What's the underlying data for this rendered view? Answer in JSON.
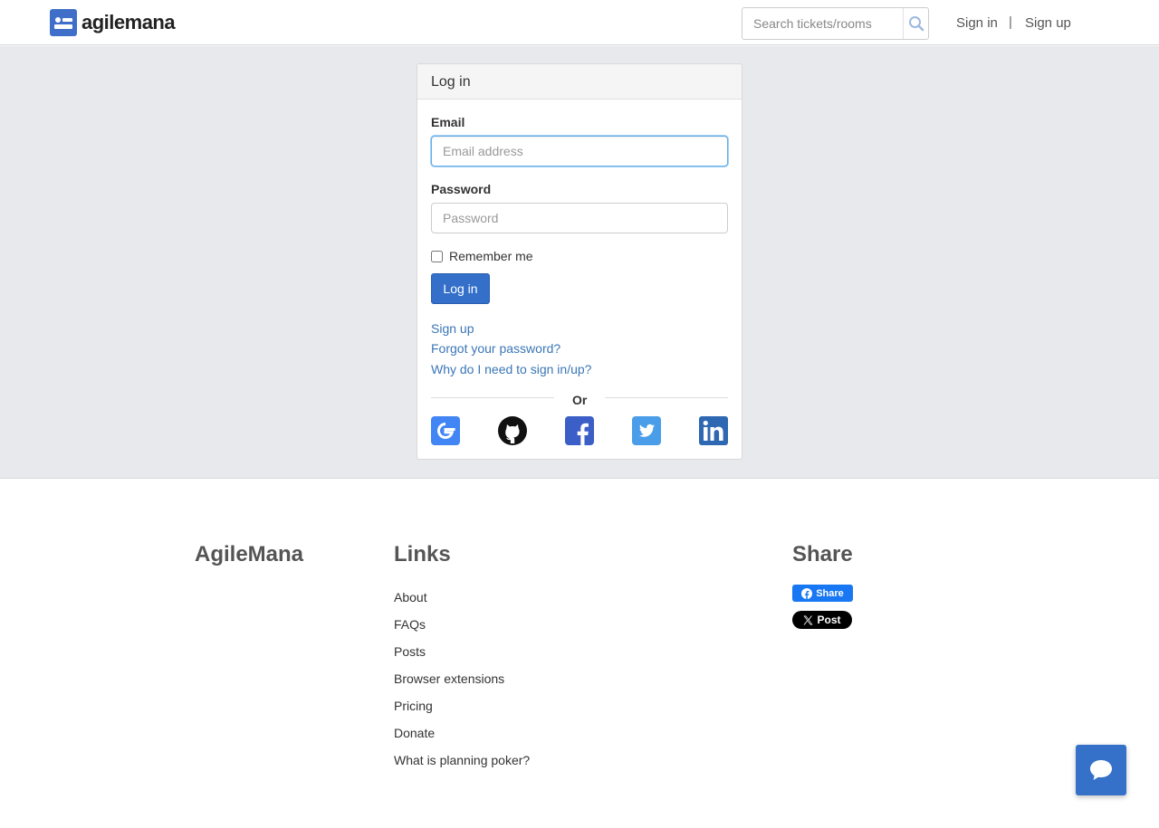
{
  "header": {
    "brand": "agilemana",
    "search_placeholder": "Search tickets/rooms",
    "signin": "Sign in",
    "separator": "|",
    "signup": "Sign up"
  },
  "login": {
    "title": "Log in",
    "email_label": "Email",
    "email_placeholder": "Email address",
    "password_label": "Password",
    "password_placeholder": "Password",
    "remember_label": "Remember me",
    "submit_label": "Log in",
    "links": [
      "Sign up",
      "Forgot your password?",
      "Why do I need to sign in/up?"
    ],
    "or_text": "Or",
    "social_icons": [
      "google-icon",
      "github-icon",
      "facebook-icon",
      "twitter-icon",
      "linkedin-icon"
    ]
  },
  "footer": {
    "brand_title": "AgileMana",
    "links_title": "Links",
    "links": [
      "About",
      "FAQs",
      "Posts",
      "Browser extensions",
      "Pricing",
      "Donate",
      "What is planning poker?"
    ],
    "share_title": "Share",
    "fb_share": "Share",
    "x_post": "Post"
  },
  "colors": {
    "accent": "#3470c9",
    "link": "#3a76b6",
    "band_bg": "#e8e9ec"
  }
}
